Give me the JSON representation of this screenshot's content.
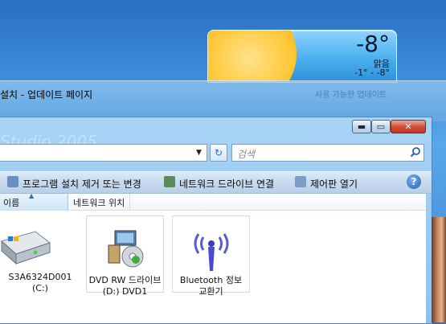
{
  "weather": {
    "temp": "-8°",
    "condition": "맑음",
    "range": "-1° - -8°"
  },
  "back_window": {
    "title": "설치 - 업데이트 페이지",
    "right_text": "사용 가능한 업데이트"
  },
  "front_window": {
    "background_text": "Studio 2005",
    "caption_buttons": {
      "minimize": "▬",
      "maximize": "▭",
      "close": "✕"
    },
    "address": {
      "dropdown": "▼",
      "refresh": "↻"
    },
    "search": {
      "placeholder": "검색",
      "icon": "magnifier-icon"
    },
    "command_bar": {
      "items": [
        "프로그램 설치 제거 또는 변경",
        "네트워크 드라이브 연결",
        "제어판 열기"
      ],
      "help": "?"
    },
    "columns": [
      "이름",
      "네트워크 위치"
    ],
    "items": [
      {
        "line1": "S3A6324D001",
        "line2": "(C:)",
        "icon": "hard-drive-icon"
      },
      {
        "line1": "DVD RW 드라이브",
        "line2": "(D:) DVD1",
        "icon": "dvd-drive-icon"
      },
      {
        "line1": "Bluetooth 정보",
        "line2": "교환기",
        "icon": "bluetooth-exchange-icon"
      }
    ]
  },
  "colors": {
    "accent": "#1c5fb0",
    "desktop": "#3f8fdc"
  }
}
